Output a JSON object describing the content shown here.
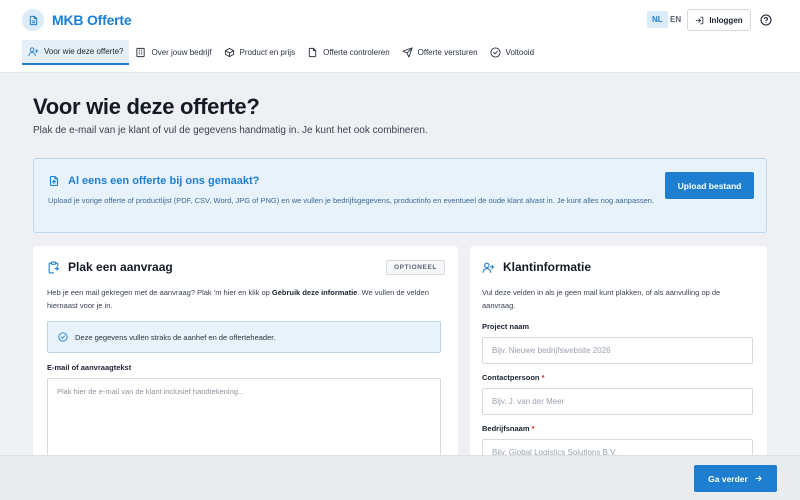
{
  "app": {
    "name": "MKB Offerte"
  },
  "header": {
    "lang_nl": "NL",
    "lang_en": "EN",
    "login_label": "Inloggen"
  },
  "steps": [
    {
      "label": "Voor wie deze offerte?",
      "active": true
    },
    {
      "label": "Over jouw bedrijf"
    },
    {
      "label": "Product en prijs"
    },
    {
      "label": "Offerte controleren"
    },
    {
      "label": "Offerte versturen"
    },
    {
      "label": "Voltooid"
    }
  ],
  "page": {
    "title": "Voor wie deze offerte?",
    "subtitle": "Plak de e-mail van je klant of vul de gegevens handmatig in. Je kunt het ook combineren."
  },
  "upload": {
    "title": "Al eens een offerte bij ons gemaakt?",
    "description": "Upload je vorige offerte of productlijst (PDF, CSV, Word, JPG of PNG) en we vullen je bedrijfsgegevens, productinfo en eventueel de oude klant alvast in. Je kunt alles nog aanpassen.",
    "button_label": "Upload bestand"
  },
  "paste_card": {
    "title": "Plak een aanvraag",
    "badge": "OPTIONEEL",
    "text_before": "Heb je een mail gekregen met de aanvraag? Plak 'm hier en klik op ",
    "text_bold": "Gebruik deze informatie",
    "text_after": ". We vullen de velden hiernaast voor je in.",
    "info": "Deze gegevens vullen straks de aanhef en de offerteheader.",
    "field_label": "E-mail of aanvraagtekst",
    "placeholder": "Plak hier de e-mail van de klant inclusief handtekening..."
  },
  "client_card": {
    "title": "Klantinformatie",
    "text": "Vul deze velden in als je geen mail kunt plakken, of als aanvulling op de aanvraag.",
    "fields": [
      {
        "label": "Project naam",
        "required": "",
        "placeholder": "Bijv. Nieuwe bedrijfswebsite 2026"
      },
      {
        "label": "Contactpersoon",
        "required": "*",
        "placeholder": "Bijv. J. van der Meer"
      },
      {
        "label": "Bedrijfsnaam",
        "required": "*",
        "placeholder": "Bijv. Global Logistics Solutions B.V."
      }
    ]
  },
  "footer": {
    "next_label": "Ga verder"
  },
  "colors": {
    "accent": "#1e7fd0",
    "info_bg": "#e8f2fb",
    "required": "#d62828"
  }
}
